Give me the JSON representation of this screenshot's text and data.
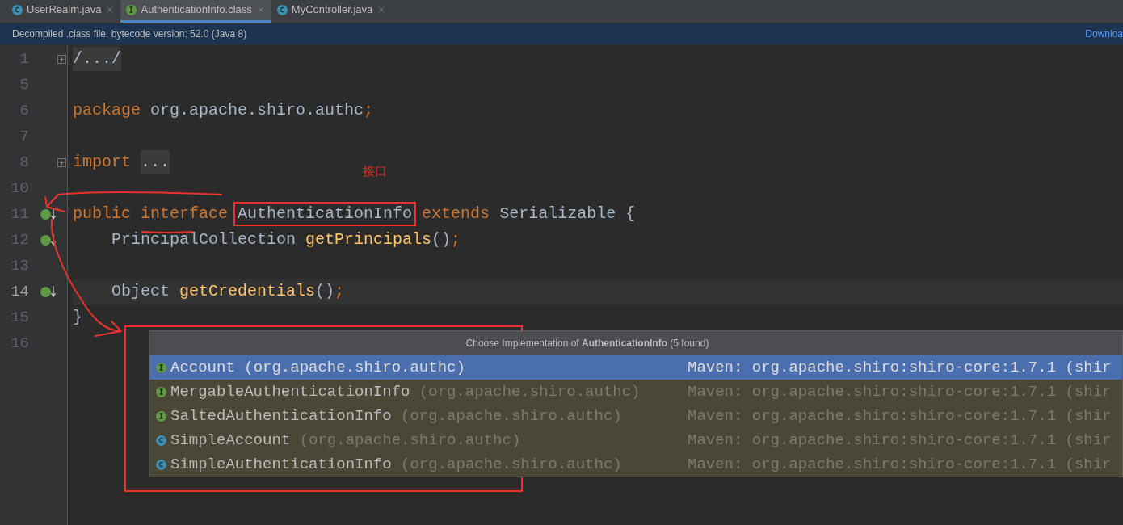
{
  "tabs": [
    {
      "label": "UserRealm.java",
      "kind": "class",
      "selected": false
    },
    {
      "label": "AuthenticationInfo.class",
      "kind": "interface",
      "selected": true
    },
    {
      "label": "MyController.java",
      "kind": "class",
      "selected": false
    }
  ],
  "banner": {
    "text": "Decompiled .class file, bytecode version: 52.0 (Java 8)",
    "link": "Downloa"
  },
  "editor": {
    "lines": [
      {
        "number": "1",
        "fold": true,
        "gutter_icon": false,
        "current": false,
        "tokens": [
          {
            "kind": "folded",
            "text": "/.../"
          }
        ]
      },
      {
        "number": "5",
        "fold": false,
        "gutter_icon": false,
        "current": false
      },
      {
        "number": "6",
        "fold": false,
        "gutter_icon": false,
        "current": false,
        "tokens": [
          {
            "kind": "keyword",
            "text": "package "
          },
          {
            "kind": "plain",
            "text": "org.apache.shiro.authc"
          },
          {
            "kind": "keyword",
            "text": ";"
          }
        ]
      },
      {
        "number": "7",
        "fold": false,
        "gutter_icon": false,
        "current": false
      },
      {
        "number": "8",
        "fold": true,
        "gutter_icon": false,
        "current": false,
        "tokens": [
          {
            "kind": "keyword",
            "text": "import "
          },
          {
            "kind": "folded",
            "text": "..."
          }
        ]
      },
      {
        "number": "10",
        "fold": false,
        "gutter_icon": false,
        "current": false
      },
      {
        "number": "11",
        "fold": false,
        "gutter_icon": true,
        "current": false,
        "tokens": [
          {
            "kind": "keyword",
            "text": "public interface "
          },
          {
            "kind": "boxed",
            "text": "AuthenticationInfo"
          },
          {
            "kind": "keyword",
            "text": " extends "
          },
          {
            "kind": "plain",
            "text": "Serializable {"
          }
        ]
      },
      {
        "number": "12",
        "fold": false,
        "gutter_icon": true,
        "current": false,
        "tokens": [
          {
            "kind": "plain",
            "text": "    PrincipalCollection "
          },
          {
            "kind": "method",
            "text": "getPrincipals"
          },
          {
            "kind": "plain",
            "text": "()"
          },
          {
            "kind": "keyword",
            "text": ";"
          }
        ]
      },
      {
        "number": "13",
        "fold": false,
        "gutter_icon": false,
        "current": false
      },
      {
        "number": "14",
        "fold": false,
        "gutter_icon": true,
        "current": true,
        "tokens": [
          {
            "kind": "plain",
            "text": "    Object "
          },
          {
            "kind": "method",
            "text": "getCredentials"
          },
          {
            "kind": "plain",
            "text": "()"
          },
          {
            "kind": "keyword",
            "text": ";"
          }
        ]
      },
      {
        "number": "15",
        "fold": false,
        "gutter_icon": false,
        "current": false,
        "tokens": [
          {
            "kind": "plain",
            "text": "}"
          }
        ]
      },
      {
        "number": "16",
        "fold": false,
        "gutter_icon": false,
        "current": false
      }
    ]
  },
  "annotation": {
    "text": "接口"
  },
  "popup": {
    "title": "Choose Implementation of **AuthenticationInfo** (5 found)",
    "items": [
      {
        "kind": "interface",
        "name": "Account",
        "package": "(org.apache.shiro.authc)",
        "location": "Maven: org.apache.shiro:shiro-core:1.7.1 (shir",
        "selected": true
      },
      {
        "kind": "interface",
        "name": "MergableAuthenticationInfo",
        "package": "(org.apache.shiro.authc)",
        "location": "Maven: org.apache.shiro:shiro-core:1.7.1 (shir",
        "selected": false
      },
      {
        "kind": "interface",
        "name": "SaltedAuthenticationInfo",
        "package": "(org.apache.shiro.authc)",
        "location": "Maven: org.apache.shiro:shiro-core:1.7.1 (shir",
        "selected": false
      },
      {
        "kind": "class",
        "name": "SimpleAccount",
        "package": "(org.apache.shiro.authc)",
        "location": "Maven: org.apache.shiro:shiro-core:1.7.1 (shir",
        "selected": false
      },
      {
        "kind": "class",
        "name": "SimpleAuthenticationInfo",
        "package": "(org.apache.shiro.authc)",
        "location": "Maven: org.apache.shiro:shiro-core:1.7.1 (shir",
        "selected": false
      }
    ]
  }
}
